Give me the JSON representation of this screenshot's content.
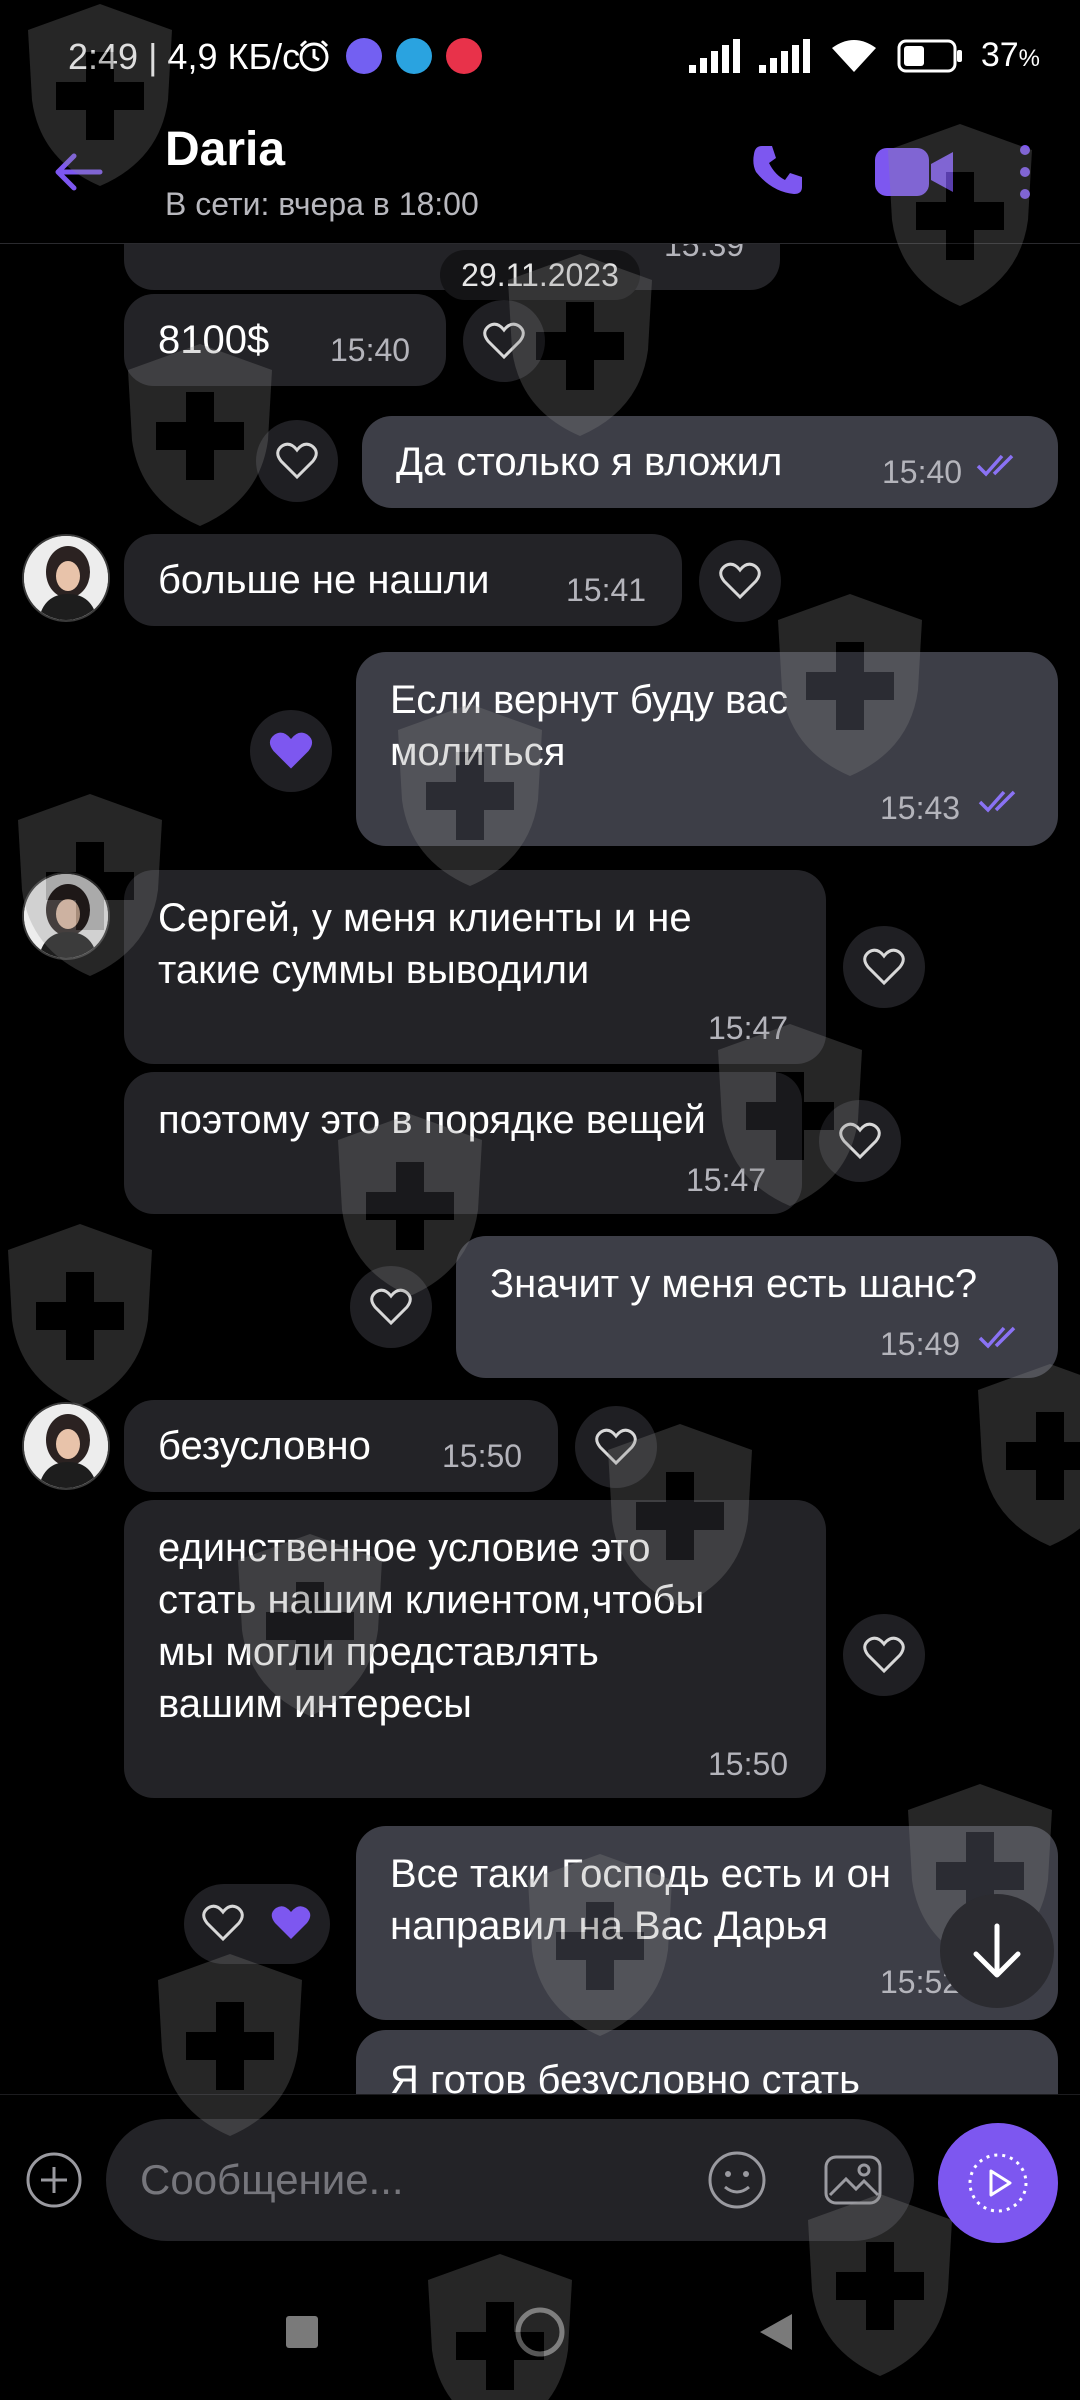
{
  "colors": {
    "accent": "#7d57f0",
    "incoming_bubble": "#232327",
    "outgoing_bubble": "#3d3e47",
    "background": "#000000",
    "time_text": "#b4b4bb"
  },
  "status_bar": {
    "time": "2:49 | 4,9 КБ/с",
    "battery": "37",
    "battery_unit": "%",
    "icons": [
      "alarm-icon",
      "viber-icon",
      "telegram-icon",
      "tiktok-icon",
      "signal-icon",
      "signal-icon",
      "wifi-icon",
      "battery-icon"
    ]
  },
  "header": {
    "contact_name": "Daria",
    "contact_status": "В сети: вчера в 18:00"
  },
  "chat": {
    "date_separator": "29.11.2023",
    "partial_top_time": "15:39",
    "messages": [
      {
        "direction": "in",
        "text": "8100$",
        "time": "15:40",
        "liked": false
      },
      {
        "direction": "out",
        "text": "Да столько я вложил",
        "time": "15:40",
        "read": true,
        "liked": false
      },
      {
        "direction": "in",
        "text": "больше не нашли",
        "time": "15:41",
        "liked": false,
        "avatar": true
      },
      {
        "direction": "out",
        "text_lines": [
          "Если вернут буду вас",
          "молиться"
        ],
        "time": "15:43",
        "read": true,
        "liked": true
      },
      {
        "direction": "in",
        "text_lines": [
          "Сергей, у меня клиенты и не",
          "такие суммы выводили"
        ],
        "time": "15:47",
        "liked": false,
        "avatar": true
      },
      {
        "direction": "in",
        "text": "поэтому это в порядке вещей",
        "time": "15:47",
        "liked": false
      },
      {
        "direction": "out",
        "text": "Значит у меня есть шанс?",
        "time": "15:49",
        "read": true,
        "liked": false
      },
      {
        "direction": "in",
        "text": "безусловно",
        "time": "15:50",
        "liked": false,
        "avatar": true
      },
      {
        "direction": "in",
        "text_lines": [
          "единственное условие это",
          "стать нашим клиентом,чтобы",
          "мы могли представлять",
          "вашим интересы"
        ],
        "time": "15:50",
        "liked": false
      },
      {
        "direction": "out",
        "text_lines": [
          "Все таки Господь есть и он",
          "направил на Вас Дарья"
        ],
        "time": "15:52",
        "liked": true
      },
      {
        "direction": "out",
        "text": "Я готов безусловно стать"
      }
    ]
  },
  "composer": {
    "placeholder": "Сообщение..."
  }
}
